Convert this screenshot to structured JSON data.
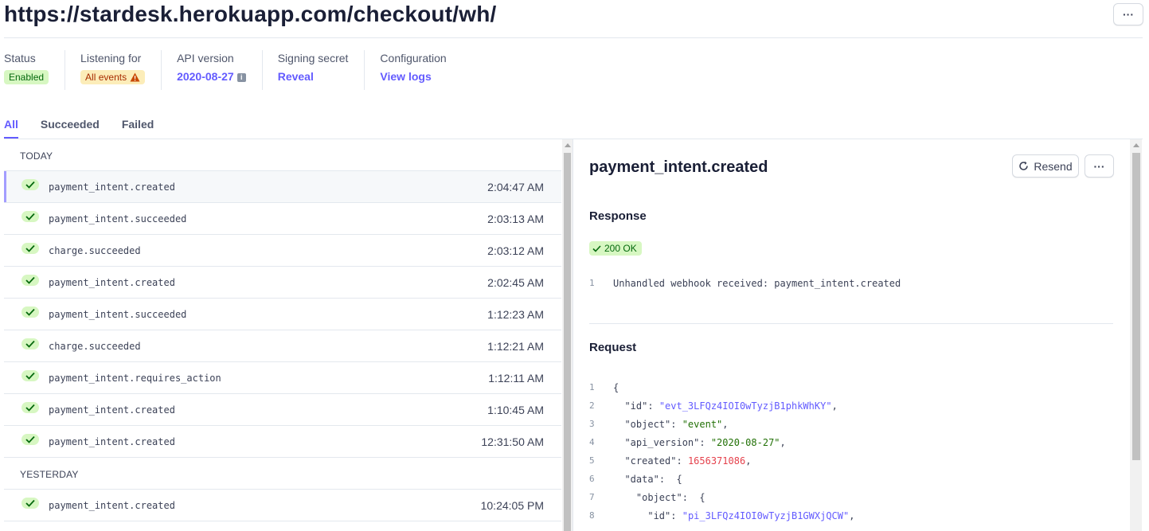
{
  "header": {
    "url_title": "https://stardesk.herokuapp.com/checkout/wh/",
    "more_label": "···"
  },
  "meta": {
    "status": {
      "label": "Status",
      "value": "Enabled"
    },
    "listening": {
      "label": "Listening for",
      "value": "All events"
    },
    "api_version": {
      "label": "API version",
      "value": "2020-08-27",
      "info": "i"
    },
    "signing_secret": {
      "label": "Signing secret",
      "value": "Reveal"
    },
    "configuration": {
      "label": "Configuration",
      "value": "View logs"
    }
  },
  "tabs": [
    {
      "label": "All",
      "active": true
    },
    {
      "label": "Succeeded",
      "active": false
    },
    {
      "label": "Failed",
      "active": false
    }
  ],
  "events": {
    "today_label": "TODAY",
    "today": [
      {
        "name": "payment_intent.created",
        "time": "2:04:47 AM"
      },
      {
        "name": "payment_intent.succeeded",
        "time": "2:03:13 AM"
      },
      {
        "name": "charge.succeeded",
        "time": "2:03:12 AM"
      },
      {
        "name": "payment_intent.created",
        "time": "2:02:45 AM"
      },
      {
        "name": "payment_intent.succeeded",
        "time": "1:12:23 AM"
      },
      {
        "name": "charge.succeeded",
        "time": "1:12:21 AM"
      },
      {
        "name": "payment_intent.requires_action",
        "time": "1:12:11 AM"
      },
      {
        "name": "payment_intent.created",
        "time": "1:10:45 AM"
      },
      {
        "name": "payment_intent.created",
        "time": "12:31:50 AM"
      }
    ],
    "yesterday_label": "YESTERDAY",
    "yesterday": [
      {
        "name": "payment_intent.created",
        "time": "10:24:05 PM"
      }
    ]
  },
  "detail": {
    "title": "payment_intent.created",
    "resend_label": "Resend",
    "more_label": "···",
    "response_heading": "Response",
    "status_badge": "200 OK",
    "response_line_no": "1",
    "response_body": "Unhandled webhook received: payment_intent.created",
    "request_heading": "Request",
    "request_lines": [
      {
        "n": "1",
        "indent": "",
        "key": "",
        "value": "",
        "kind": "plain",
        "text": "{"
      },
      {
        "n": "2",
        "indent": "  ",
        "key": "\"id\"",
        "value": "\"evt_3LFQz4IOI0wTyzjB1phkWhKY\"",
        "kind": "str",
        "text": ","
      },
      {
        "n": "3",
        "indent": "  ",
        "key": "\"object\"",
        "value": "\"event\"",
        "kind": "valstr",
        "text": ","
      },
      {
        "n": "4",
        "indent": "  ",
        "key": "\"api_version\"",
        "value": "\"2020-08-27\"",
        "kind": "valstr",
        "text": ","
      },
      {
        "n": "5",
        "indent": "  ",
        "key": "\"created\"",
        "value": "1656371086",
        "kind": "num",
        "text": ","
      },
      {
        "n": "6",
        "indent": "  ",
        "key": "\"data\"",
        "value": "",
        "kind": "plain",
        "text": " {"
      },
      {
        "n": "7",
        "indent": "    ",
        "key": "\"object\"",
        "value": "",
        "kind": "plain",
        "text": " {"
      },
      {
        "n": "8",
        "indent": "      ",
        "key": "\"id\"",
        "value": "\"pi_3LFQz4IOI0wTyzjB1GWXjQCW\"",
        "kind": "str",
        "text": ","
      }
    ]
  }
}
